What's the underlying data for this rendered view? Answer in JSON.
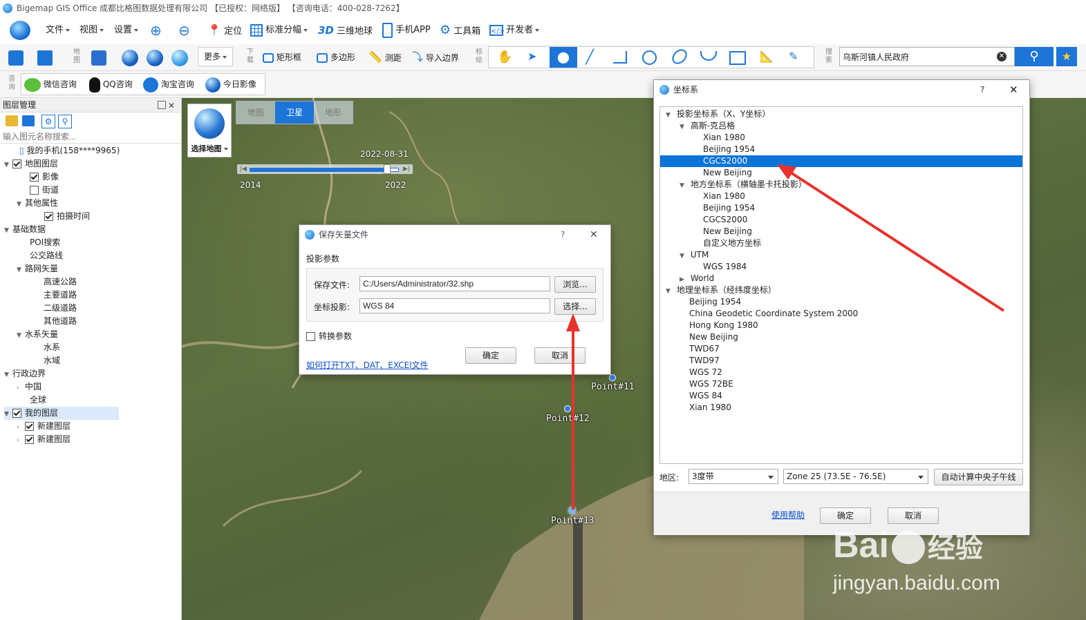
{
  "window": {
    "title": "Bigemap GIS Office 成都比格图数据处理有限公司 【已授权：网络版】 【咨询电话：400-028-7262】"
  },
  "menu": {
    "file": "文件",
    "view": "视图",
    "settings": "设置",
    "locate": "定位",
    "grid": "标准分幅",
    "earth": "三维地球",
    "earth_prefix": "3D",
    "app": "手机APP",
    "tools": "工具箱",
    "dev": "开发者"
  },
  "toolbar": {
    "map_group": "地图",
    "more": "更多",
    "download_group": "下载",
    "rect": "矩形框",
    "polygon": "多边形",
    "measure": "测距",
    "import": "导入边界",
    "mark_group": "标绘",
    "search_group": "搜索",
    "search_value": "乌斯河镇人民政府"
  },
  "toolbar2": {
    "consult_group": "咨询",
    "wechat": "微信咨询",
    "qq": "QQ咨询",
    "taobao": "淘宝咨询",
    "today": "今日影像"
  },
  "layers": {
    "title": "图层管理",
    "search_placeholder": "输入图元名称搜索...",
    "items": [
      {
        "label": "我的手机(158****9965)"
      },
      {
        "label": "地图图层"
      },
      {
        "label": "影像"
      },
      {
        "label": "街道"
      },
      {
        "label": "其他属性"
      },
      {
        "label": "拍摄时间"
      },
      {
        "label": "基础数据"
      },
      {
        "label": "POI搜索"
      },
      {
        "label": "公交路线"
      },
      {
        "label": "路网矢量"
      },
      {
        "label": "高速公路"
      },
      {
        "label": "主要道路"
      },
      {
        "label": "二级道路"
      },
      {
        "label": "其他道路"
      },
      {
        "label": "水系矢量"
      },
      {
        "label": "水系"
      },
      {
        "label": "水域"
      },
      {
        "label": "行政边界"
      },
      {
        "label": "中国"
      },
      {
        "label": "全球"
      },
      {
        "label": "我的图层"
      },
      {
        "label": "新建图层"
      },
      {
        "label": "新建图层"
      }
    ]
  },
  "map": {
    "select_map": "选择地图",
    "tabs": [
      "地图",
      "卫星",
      "地形"
    ],
    "timeline": {
      "date": "2022-08-31",
      "start": "2014",
      "end": "2022",
      "position": 0.93
    },
    "points": [
      "Point#11",
      "Point#12",
      "Point#13"
    ]
  },
  "save_dialog": {
    "title": "保存矢量文件",
    "help": "?",
    "section": "投影参数",
    "file_label": "保存文件:",
    "file_value": "C:/Users/Administrator/32.shp",
    "browse": "浏览...",
    "proj_label": "坐标投影:",
    "proj_value": "WGS 84",
    "choose": "选择...",
    "convert": "转换参数",
    "ok": "确定",
    "cancel": "取消",
    "link": "如何打开TXT、DAT、EXCEl文件"
  },
  "crs_dialog": {
    "title": "坐标系",
    "help": "?",
    "tree": [
      {
        "label": "投影坐标系（X、Y坐标）"
      },
      {
        "label": "高斯-克吕格"
      },
      {
        "label": "Xian 1980"
      },
      {
        "label": "Beijing 1954"
      },
      {
        "label": "CGCS2000"
      },
      {
        "label": "New Beijing"
      },
      {
        "label": "地方坐标系（横轴墨卡托投影）"
      },
      {
        "label": "Xian 1980"
      },
      {
        "label": "Beijing 1954"
      },
      {
        "label": "CGCS2000"
      },
      {
        "label": "New Beijing"
      },
      {
        "label": "自定义地方坐标"
      },
      {
        "label": "UTM"
      },
      {
        "label": "WGS 1984"
      },
      {
        "label": "World"
      },
      {
        "label": "地理坐标系（经纬度坐标）"
      },
      {
        "label": "Beijing 1954"
      },
      {
        "label": "China Geodetic Coordinate System 2000"
      },
      {
        "label": "Hong Kong 1980"
      },
      {
        "label": "New Beijing"
      },
      {
        "label": "TWD67"
      },
      {
        "label": "TWD97"
      },
      {
        "label": "WGS 72"
      },
      {
        "label": "WGS 72BE"
      },
      {
        "label": "WGS 84"
      },
      {
        "label": "Xian 1980"
      }
    ],
    "region_label": "地区:",
    "band_value": "3度带",
    "zone_value": "Zone 25 (73.5E - 76.5E)",
    "auto": "自动计算中央子午线",
    "help_link": "使用帮助",
    "ok": "确定",
    "cancel": "取消"
  },
  "watermark": {
    "brand": "Bai",
    "brand2": "经验",
    "url": "jingyan.baidu.com"
  },
  "colors": {
    "accent": "#0a74d8",
    "arrow": "#e8322c"
  }
}
